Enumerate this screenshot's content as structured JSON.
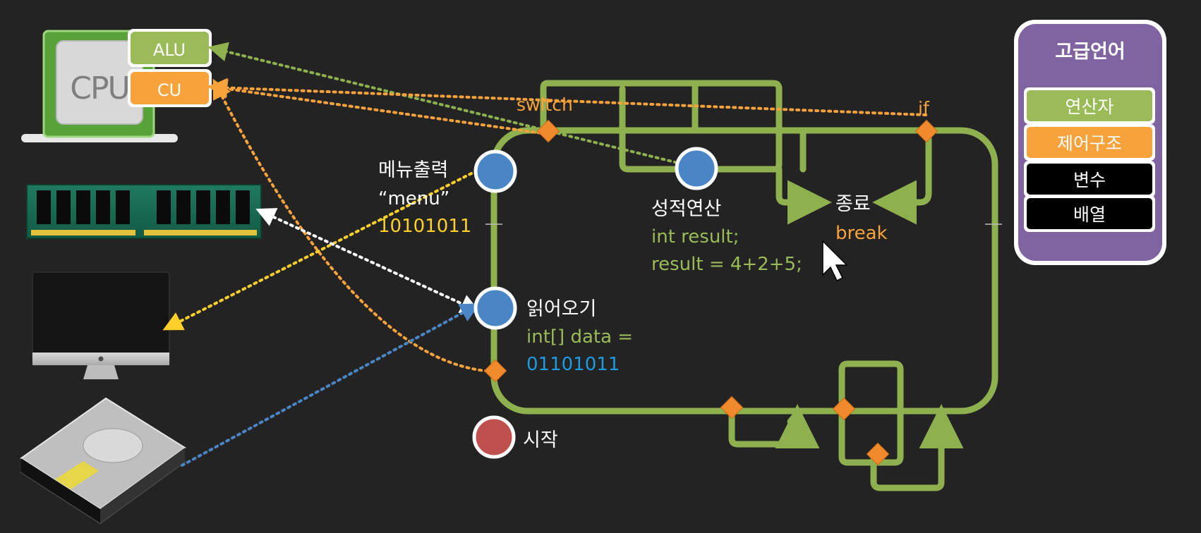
{
  "hardware": {
    "cpu_label": "CPU",
    "alu_label": "ALU",
    "cu_label": "CU"
  },
  "flow": {
    "switch_label": "switch",
    "if_label": "if",
    "menu_node": {
      "title": "메뉴출력",
      "line2": "“menu”",
      "line3": "10101011"
    },
    "calc_node": {
      "title": "성적연산",
      "line2": "int result;",
      "line3": "result = 4+2+5;"
    },
    "end_node": {
      "title": "종료",
      "line2": "break"
    },
    "read_node": {
      "title": "읽어오기",
      "line2": "int[] data =",
      "line3": "01101011"
    },
    "start_node": {
      "title": "시작"
    }
  },
  "legend": {
    "title": "고급언어",
    "items": [
      "연산자",
      "제어구조",
      "변수",
      "배열"
    ]
  },
  "colors": {
    "background": "#232323",
    "loop_green": "#8fb04f",
    "accent_orange": "#f7a23b",
    "text_green": "#9bbb59",
    "text_yellow": "#ffd02a",
    "text_blue": "#1e9be0",
    "node_blue": "#4a86c5",
    "node_red": "#c0504d",
    "legend_purple": "#8064a2"
  },
  "icons": [
    "cpu-chip-icon",
    "ram-module-icon",
    "monitor-icon",
    "hard-drive-icon",
    "mouse-cursor-icon"
  ]
}
